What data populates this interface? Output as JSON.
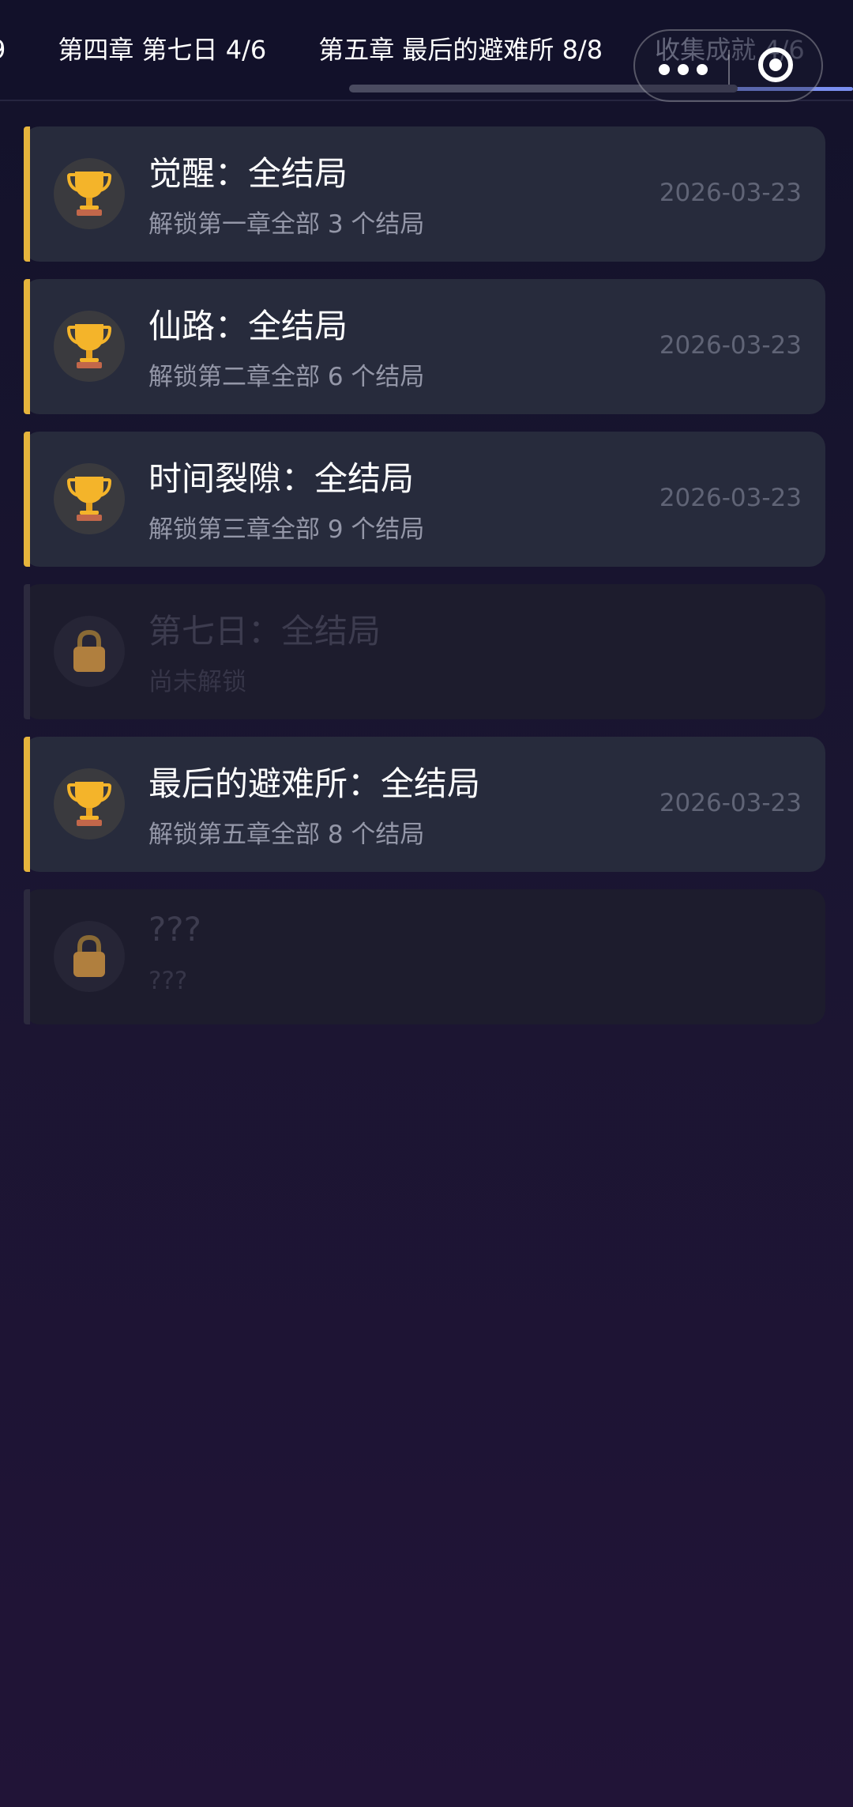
{
  "tabs": [
    {
      "label": "9"
    },
    {
      "label": "第四章 第七日 4/6"
    },
    {
      "label": "第五章 最后的避难所 8/8"
    },
    {
      "label": "收集成就 4/6"
    }
  ],
  "achievements": [
    {
      "title": "觉醒：全结局",
      "desc": "解锁第一章全部 3 个结局",
      "date": "2026-03-23",
      "icon": "trophy-icon"
    },
    {
      "title": "仙路：全结局",
      "desc": "解锁第二章全部 6 个结局",
      "date": "2026-03-23",
      "icon": "trophy-icon"
    },
    {
      "title": "时间裂隙：全结局",
      "desc": "解锁第三章全部 9 个结局",
      "date": "2026-03-23",
      "icon": "trophy-icon"
    },
    {
      "title": "第七日：全结局",
      "desc": "尚未解锁",
      "date": "",
      "icon": "lock-icon"
    },
    {
      "title": "最后的避难所：全结局",
      "desc": "解锁第五章全部 8 个结局",
      "date": "2026-03-23",
      "icon": "trophy-icon"
    },
    {
      "title": "???",
      "desc": "???",
      "date": "",
      "icon": "lock-icon"
    }
  ],
  "colors": {
    "accent": "#e6b43c",
    "card": "#272b3c",
    "card_locked": "#1d1c2d",
    "tab_indicator": "#7b8ff0"
  }
}
